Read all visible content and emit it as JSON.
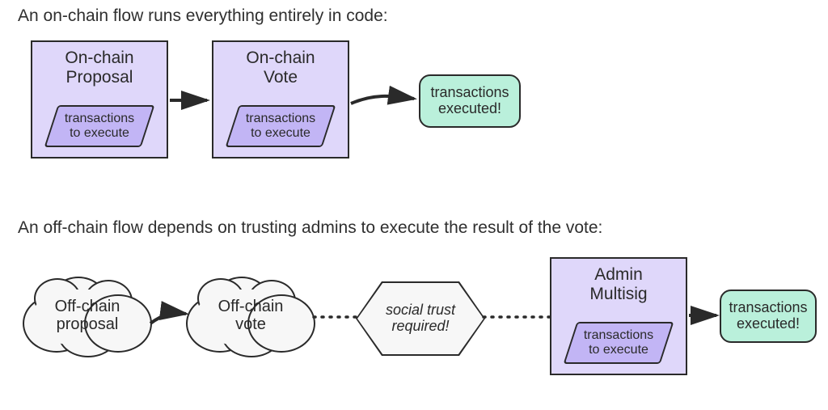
{
  "caption_top": "An on-chain flow runs everything entirely in code:",
  "caption_bottom": "An off-chain flow depends on trusting admins to execute the result of the vote:",
  "onchain": {
    "proposal": {
      "title": "On-chain\nProposal",
      "payload": "transactions\nto execute"
    },
    "vote": {
      "title": "On-chain\nVote",
      "payload": "transactions\nto execute"
    },
    "result": "transactions\nexecuted!"
  },
  "offchain": {
    "proposal": "Off-chain\nproposal",
    "vote": "Off-chain\nvote",
    "trust": "social trust\nrequired!",
    "multisig": {
      "title": "Admin\nMultisig",
      "payload": "transactions\nto execute"
    },
    "result": "transactions\nexecuted!"
  },
  "colors": {
    "bigbox_bg": "#dfd7fa",
    "parallelogram_bg": "#c2b5f5",
    "result_bg": "#baf0db",
    "cloud_bg": "#f7f7f7",
    "stroke": "#2a2a2a"
  }
}
